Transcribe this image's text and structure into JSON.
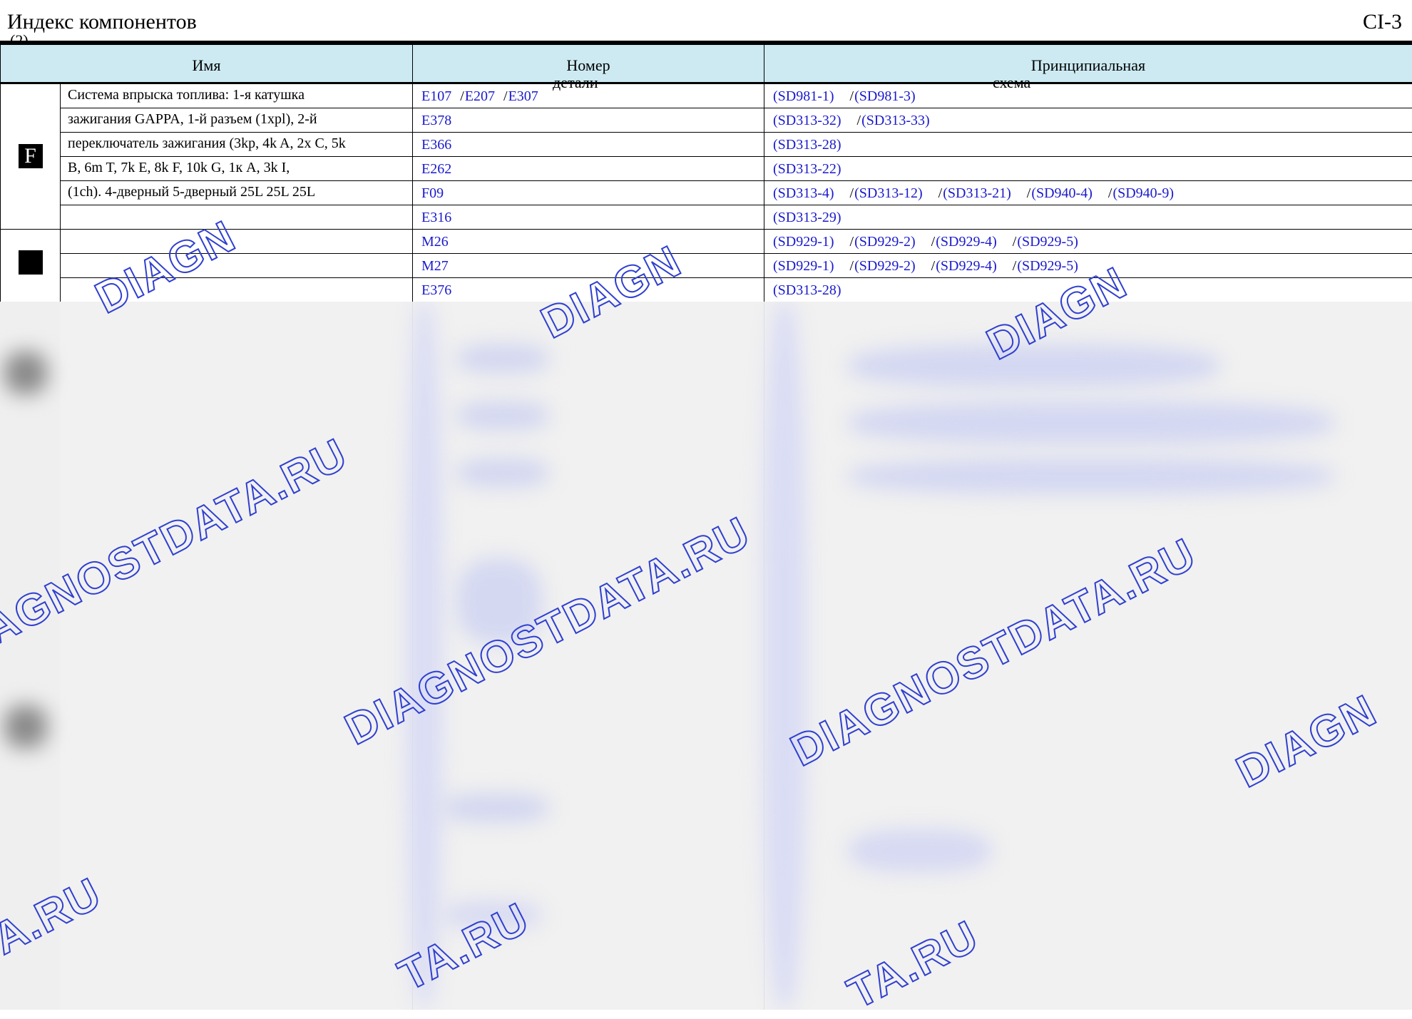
{
  "header": {
    "title": "Индекс компонентов",
    "subtitle": "(2)",
    "page_code": "CI-3"
  },
  "table": {
    "columns": {
      "name": "Имя",
      "part_line1": "Номер",
      "part_line2": "детали",
      "schematic_line1": "Принципиальная",
      "schematic_line2": "схема"
    },
    "groups": [
      {
        "marker": "F",
        "name_lines": [
          "Система впрыска топлива: 1-я катушка",
          "зажигания GAPPA, 1-й разъем (1xpl), 2-й",
          "переключатель зажигания (3kp, 4k A, 2x C, 5k",
          "B, 6m T, 7k E, 8k F, 10k G, 1к A, 3k I,",
          "(1ch). 4-дверный 5-дверный 25L 25L 25L",
          ""
        ],
        "rows": [
          {
            "parts": [
              "E107",
              "E207",
              "E307"
            ],
            "schematics": [
              "(SD981-1)",
              "(SD981-3)"
            ]
          },
          {
            "parts": [
              "E378"
            ],
            "schematics": [
              "(SD313-32)",
              "(SD313-33)"
            ]
          },
          {
            "parts": [
              "E366"
            ],
            "schematics": [
              "(SD313-28)"
            ]
          },
          {
            "parts": [
              "E262"
            ],
            "schematics": [
              "(SD313-22)"
            ]
          },
          {
            "parts": [
              "F09"
            ],
            "schematics": [
              "(SD313-4)",
              "(SD313-12)",
              "(SD313-21)",
              "(SD940-4)",
              "(SD940-9)"
            ]
          },
          {
            "parts": [
              "E316"
            ],
            "schematics": [
              "(SD313-29)"
            ]
          }
        ]
      },
      {
        "marker": "",
        "name_lines": [
          "",
          "",
          ""
        ],
        "rows": [
          {
            "parts": [
              "M26"
            ],
            "schematics": [
              "(SD929-1)",
              "(SD929-2)",
              "(SD929-4)",
              "(SD929-5)"
            ]
          },
          {
            "parts": [
              "M27"
            ],
            "schematics": [
              "(SD929-1)",
              "(SD929-2)",
              "(SD929-4)",
              "(SD929-5)"
            ]
          },
          {
            "parts": [
              "E376"
            ],
            "schematics": [
              "(SD313-28)"
            ]
          }
        ]
      }
    ]
  },
  "watermarks": {
    "brand": "DIAGNOSTDATA.RU",
    "fragment_diag": "DIAGN",
    "fragment_ru": "TA.RU",
    "color": "#2f3fd0"
  },
  "colors": {
    "header_bg": "#cdeaf2",
    "link": "#1a1acc",
    "blur_bg": "#f1f1f1"
  }
}
